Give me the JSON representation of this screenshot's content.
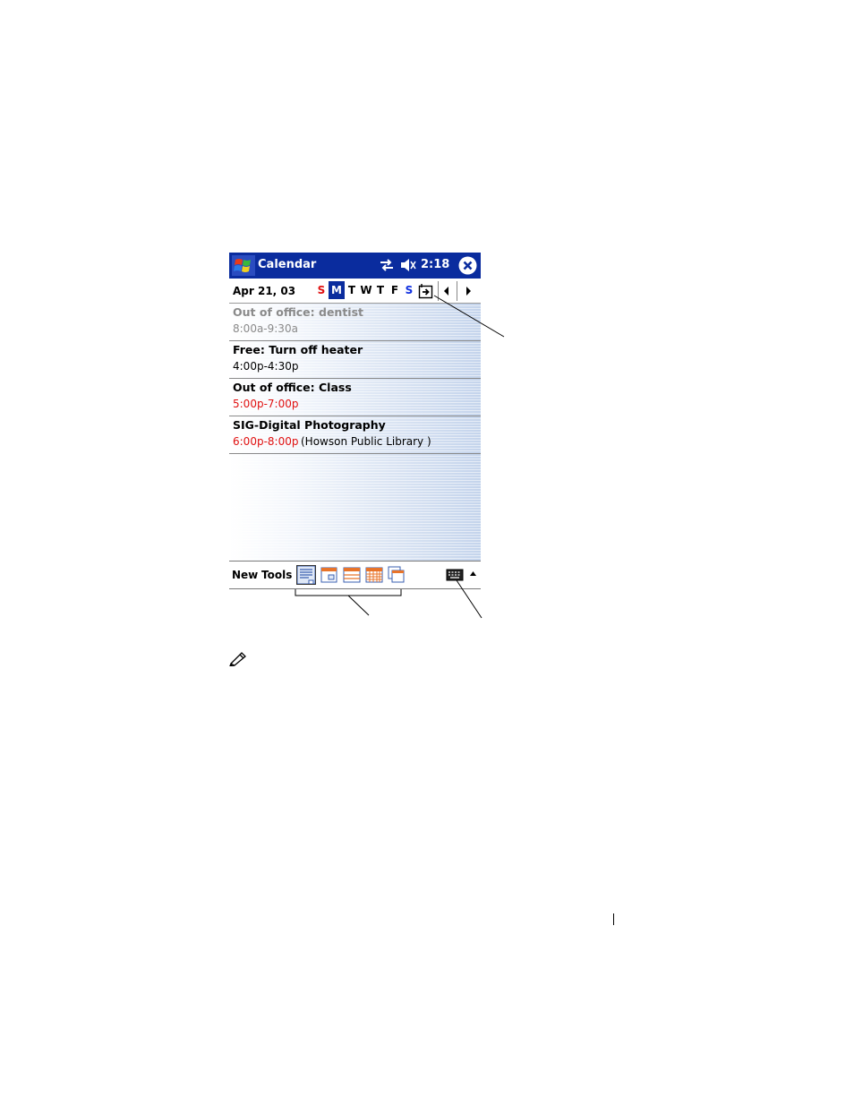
{
  "titlebar": {
    "app_title": "Calendar",
    "clock": "2:18",
    "icons": [
      "windows-flag-icon",
      "connectivity-icon",
      "speaker-icon",
      "close-icon"
    ]
  },
  "datebar": {
    "date": "Apr 21, 03",
    "week_days": [
      {
        "label": "S",
        "kind": "sun"
      },
      {
        "label": "M",
        "kind": "selected"
      },
      {
        "label": "T",
        "kind": ""
      },
      {
        "label": "W",
        "kind": ""
      },
      {
        "label": "T",
        "kind": ""
      },
      {
        "label": "F",
        "kind": ""
      },
      {
        "label": "S",
        "kind": "sat"
      }
    ]
  },
  "appointments": [
    {
      "title": "Out of office: dentist",
      "time": "8:00a-9:30a",
      "location": "",
      "style": "gray"
    },
    {
      "title": "Free: Turn off heater",
      "time": "4:00p-4:30p",
      "location": "",
      "style": "normal"
    },
    {
      "title": "Out of office: Class",
      "time": "5:00p-7:00p",
      "location": "",
      "style": "red"
    },
    {
      "title": "SIG-Digital Photography",
      "time": "6:00p-8:00p",
      "location": "(Howson Public Library )",
      "style": "red"
    }
  ],
  "cmdbar": {
    "new_label": "New",
    "tools_label": "Tools"
  },
  "colors": {
    "titlebar": "#0a2c9e",
    "sunday": "#e01010",
    "saturday": "#1030e0",
    "conflict_time": "#e01010"
  }
}
